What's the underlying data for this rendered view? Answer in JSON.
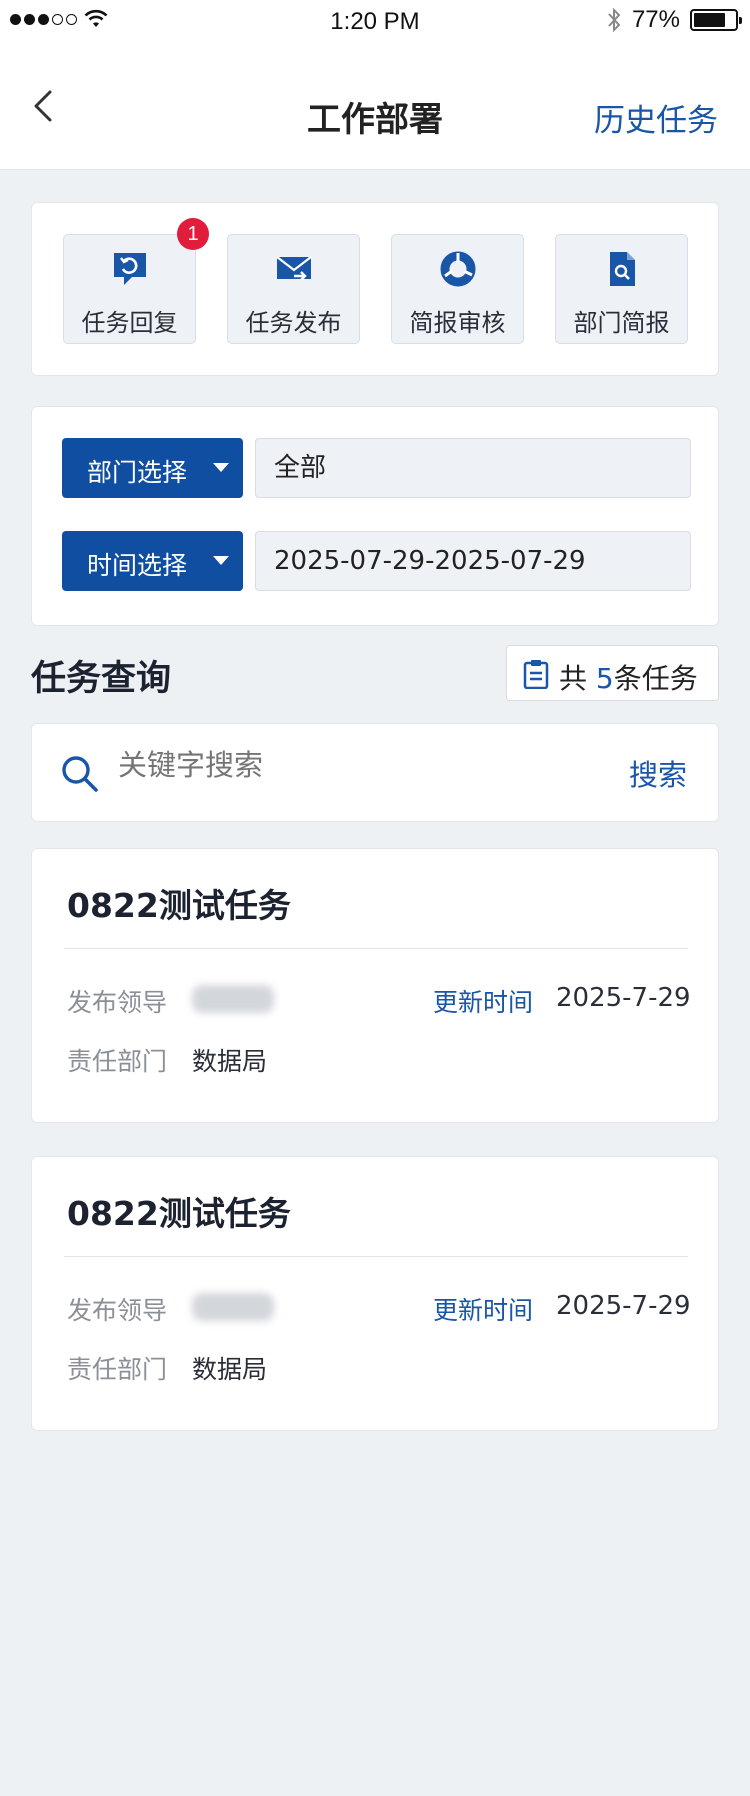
{
  "status_bar": {
    "time": "1:20 PM",
    "battery": "77%",
    "battery_level": 0.77
  },
  "nav": {
    "title": "工作部署",
    "right_action": "历史任务"
  },
  "quick_actions": [
    {
      "label": "任务回复",
      "icon": "reply-icon",
      "badge": "1"
    },
    {
      "label": "任务发布",
      "icon": "mail-forward-icon",
      "badge": null
    },
    {
      "label": "简报审核",
      "icon": "review-ring-icon",
      "badge": null
    },
    {
      "label": "部门简报",
      "icon": "document-search-icon",
      "badge": null
    }
  ],
  "filters": {
    "department": {
      "button": "部门选择",
      "value": "全部"
    },
    "time": {
      "button": "时间选择",
      "value": "2025-07-29-2025-07-29"
    }
  },
  "query": {
    "title": "任务查询",
    "count_prefix": "共 ",
    "count": "5",
    "count_suffix": "条任务"
  },
  "search": {
    "placeholder": "关键字搜索",
    "button": "搜索"
  },
  "tasks": [
    {
      "title": "0822测试任务",
      "leader_label": "发布领导",
      "update_label": "更新时间",
      "update_time": "2025-7-29",
      "dept_label": "责任部门",
      "dept": "数据局"
    },
    {
      "title": "0822测试任务",
      "leader_label": "发布领导",
      "update_label": "更新时间",
      "update_time": "2025-7-29",
      "dept_label": "责任部门",
      "dept": "数据局"
    }
  ],
  "colors": {
    "accent": "#1a56a8",
    "primary_button": "#0f4ea1",
    "badge": "#e01e3c",
    "background": "#eef1f4"
  }
}
